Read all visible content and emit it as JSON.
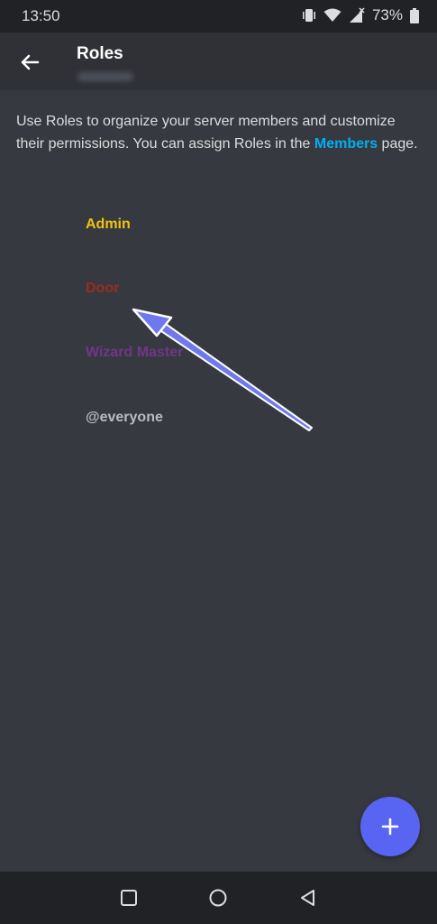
{
  "status_bar": {
    "time": "13:50",
    "battery_percent": "73%",
    "icons": [
      "vibrate-icon",
      "wifi-icon",
      "signal-icon",
      "battery-icon"
    ]
  },
  "header": {
    "title": "Roles"
  },
  "intro": {
    "text_before": "Use Roles to organize your server members and customize their permissions. You can assign Roles in the ",
    "link_text": "Members",
    "text_after": " page."
  },
  "roles": [
    {
      "name": "Admin",
      "color": "#f1c40f"
    },
    {
      "name": "Door",
      "color": "#992d22"
    },
    {
      "name": "Wizard Master",
      "color": "#71368a"
    },
    {
      "name": "@everyone",
      "color": "#b9bbbe"
    }
  ],
  "fab": {
    "icon": "plus-icon"
  },
  "nav_bar": {
    "icons": [
      "recents-icon",
      "home-icon",
      "back-nav-icon"
    ]
  },
  "colors": {
    "background": "#36393f",
    "header": "#2f3136",
    "system_bars": "#202225",
    "accent": "#5865f2",
    "link": "#00aff4"
  }
}
